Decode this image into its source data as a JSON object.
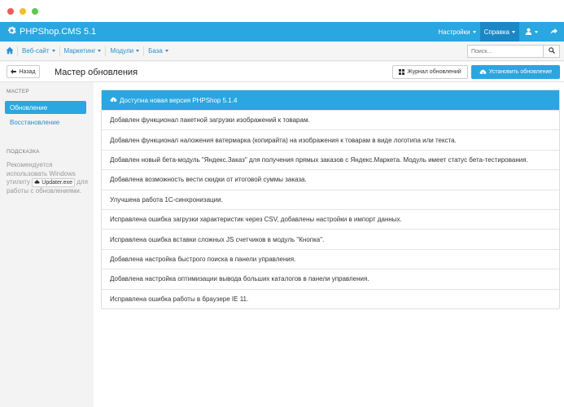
{
  "window": {
    "controls": [
      "close",
      "minimize",
      "maximize"
    ]
  },
  "navbar": {
    "brand": "PHPShop.CMS 5.1",
    "brand_icon": "gear-icon",
    "items": [
      {
        "label": "Настройки",
        "active": false
      },
      {
        "label": "Справка",
        "active": true
      }
    ],
    "user_icon": "user-icon",
    "logout_icon": "share-icon"
  },
  "menubar": {
    "home_icon": "home-icon",
    "items": [
      {
        "label": "Веб-сайт"
      },
      {
        "label": "Маркетинг"
      },
      {
        "label": "Модули"
      },
      {
        "label": "База"
      }
    ],
    "search": {
      "placeholder": "Поиск..."
    }
  },
  "toolbar": {
    "back_label": "Назад",
    "title": "Мастер обновления",
    "journal_label": "Журнал обновлений",
    "install_label": "Установить обновление"
  },
  "sidebar": {
    "section1_heading": "Мастер",
    "items": [
      {
        "label": "Обновление",
        "active": true
      },
      {
        "label": "Восстановление",
        "active": false
      }
    ],
    "section2_heading": "Подсказка",
    "hint_before": "Рекомендуется использовать Windows утилиту",
    "hint_tool": "Updater.exe",
    "hint_after": "для работы с обновлениями."
  },
  "panel": {
    "header": "Доступна новая версия PHPShop 5.1.4",
    "changes": [
      "Добавлен функционал пакетной загрузки изображений к товарам.",
      "Добавлен функционал наложения ватермарка (копирайта) на изображения к товарам в виде логотипа или текста.",
      "Добавлен новый бета-модуль \"Яндекс.Заказ\" для получения прямых заказов с Яндекс.Маркета. Модуль имеет статус бета-тестирования.",
      "Добавлена возможность вести скидки от итоговой суммы заказа.",
      "Улучшена работа 1С-синхронизации.",
      "Исправлена ошибка загрузки характеристик через CSV, добавлены настройки в импорт данных.",
      "Исправлена ошибка вставки сложных JS счетчиков в модуль \"Кнопка\".",
      "Добавлена настройка быстрого поиска в панели управления.",
      "Добавлена настройка оптимизации вывода больших каталогов в панели управления.",
      "Исправлена ошибка работы в браузере IE 11."
    ]
  },
  "colors": {
    "accent": "#2aa6e0",
    "accent_dark": "#1b87c4",
    "link": "#2a8fd0"
  }
}
